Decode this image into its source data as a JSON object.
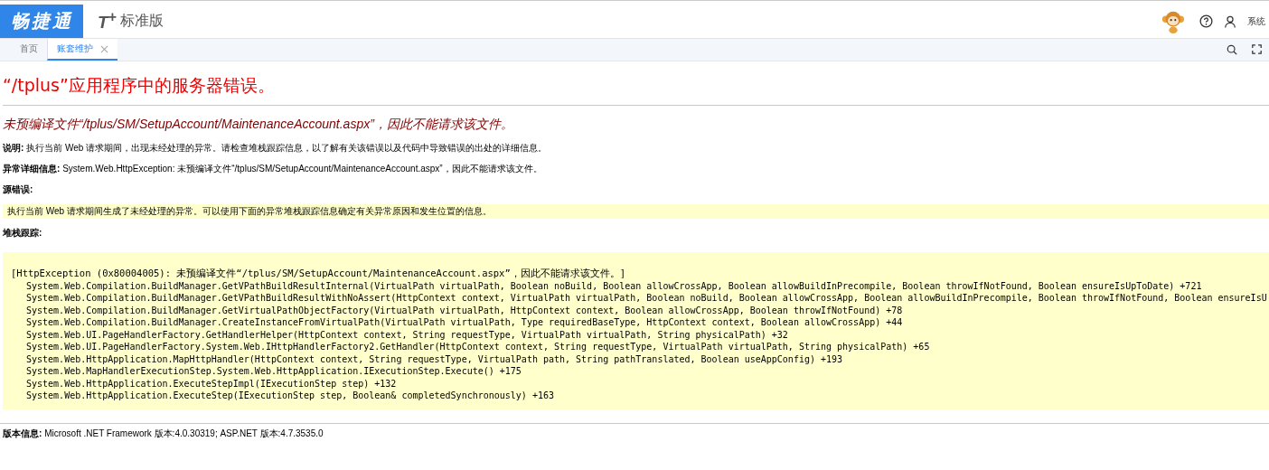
{
  "header": {
    "logo_text": "畅捷通",
    "product_mark": "T$^{+}$",
    "edition": "标准版",
    "user_name": "系统"
  },
  "tabs": [
    {
      "label": "首页",
      "selected": false,
      "closable": false
    },
    {
      "label": "账套维护",
      "selected": true,
      "closable": true
    }
  ],
  "error": {
    "title": "“/tplus”应用程序中的服务器错误。",
    "subtitle": "未预编译文件“/tplus/SM/SetupAccount/MaintenanceAccount.aspx”，因此不能请求该文件。",
    "description": {
      "label": "说明:",
      "text": "执行当前 Web 请求期间，出现未经处理的异常。请检查堆栈跟踪信息，以了解有关该错误以及代码中导致错误的出处的详细信息。"
    },
    "details": {
      "label": "异常详细信息:",
      "text": "System.Web.HttpException: 未预编译文件“/tplus/SM/SetupAccount/MaintenanceAccount.aspx”，因此不能请求该文件。"
    },
    "source_error": {
      "label": "源错误:",
      "text": "执行当前 Web 请求期间生成了未经处理的异常。可以使用下面的异常堆栈跟踪信息确定有关异常原因和发生位置的信息。"
    },
    "stack_trace": {
      "label": "堆栈跟踪:",
      "lines": [
        {
          "kind": "exception",
          "text": "[HttpException (0x80004005): 未预编译文件“/tplus/SM/SetupAccount/MaintenanceAccount.aspx”，因此不能请求该文件。]"
        },
        {
          "kind": "frame",
          "text": "System.Web.Compilation.BuildManager.GetVPathBuildResultInternal(VirtualPath virtualPath, Boolean noBuild, Boolean allowCrossApp, Boolean allowBuildInPrecompile, Boolean throwIfNotFound, Boolean ensureIsUpToDate) +721"
        },
        {
          "kind": "frame",
          "text": "System.Web.Compilation.BuildManager.GetVPathBuildResultWithNoAssert(HttpContext context, VirtualPath virtualPath, Boolean noBuild, Boolean allowCrossApp, Boolean allowBuildInPrecompile, Boolean throwIfNotFound, Boolean ensureIsU"
        },
        {
          "kind": "frame",
          "text": "System.Web.Compilation.BuildManager.GetVirtualPathObjectFactory(VirtualPath virtualPath, HttpContext context, Boolean allowCrossApp, Boolean throwIfNotFound) +78"
        },
        {
          "kind": "frame",
          "text": "System.Web.Compilation.BuildManager.CreateInstanceFromVirtualPath(VirtualPath virtualPath, Type requiredBaseType, HttpContext context, Boolean allowCrossApp) +44"
        },
        {
          "kind": "frame",
          "text": "System.Web.UI.PageHandlerFactory.GetHandlerHelper(HttpContext context, String requestType, VirtualPath virtualPath, String physicalPath) +32"
        },
        {
          "kind": "frame",
          "text": "System.Web.UI.PageHandlerFactory.System.Web.IHttpHandlerFactory2.GetHandler(HttpContext context, String requestType, VirtualPath virtualPath, String physicalPath) +65"
        },
        {
          "kind": "frame",
          "text": "System.Web.HttpApplication.MapHttpHandler(HttpContext context, String requestType, VirtualPath path, String pathTranslated, Boolean useAppConfig) +193"
        },
        {
          "kind": "frame",
          "text": "System.Web.MapHandlerExecutionStep.System.Web.HttpApplication.IExecutionStep.Execute() +175"
        },
        {
          "kind": "frame",
          "text": "System.Web.HttpApplication.ExecuteStepImpl(IExecutionStep step) +132"
        },
        {
          "kind": "frame",
          "text": "System.Web.HttpApplication.ExecuteStep(IExecutionStep step, Boolean& completedSynchronously) +163"
        }
      ]
    },
    "version": {
      "label": "版本信息:",
      "text": "Microsoft .NET Framework 版本:4.0.30319; ASP.NET 版本:4.7.3535.0"
    }
  }
}
